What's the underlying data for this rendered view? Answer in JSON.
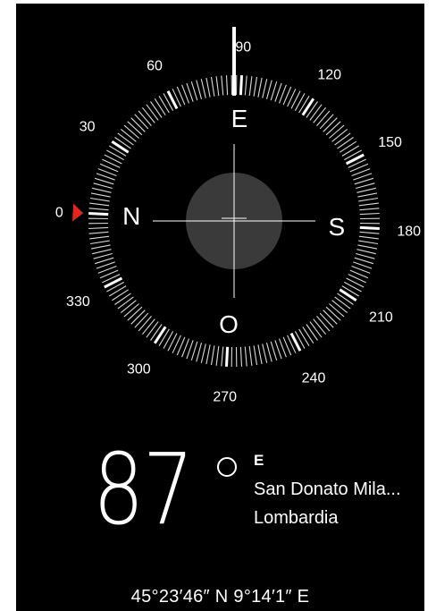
{
  "compass": {
    "heading_marker": "white-indicator-line",
    "current_heading_text": "87°",
    "cardinals": {
      "north": "N",
      "east": "E",
      "south": "S",
      "west": "O"
    },
    "degree_labels": [
      "0",
      "30",
      "60",
      "90",
      "120",
      "150",
      "180",
      "210",
      "240",
      "270",
      "300",
      "330"
    ],
    "north_pointer_icon": "red-triangle-icon",
    "colors": {
      "background": "#000000",
      "ticks": "#ffffff",
      "north_pointer": "#e0261e",
      "level_disc": "#3a3a3a"
    }
  },
  "reading": {
    "degrees": "87",
    "direction": "E",
    "city": "San Donato Mila...",
    "region": "Lombardia"
  },
  "coordinates": {
    "text": "45°23′46″ N  9°14′1″ E"
  }
}
